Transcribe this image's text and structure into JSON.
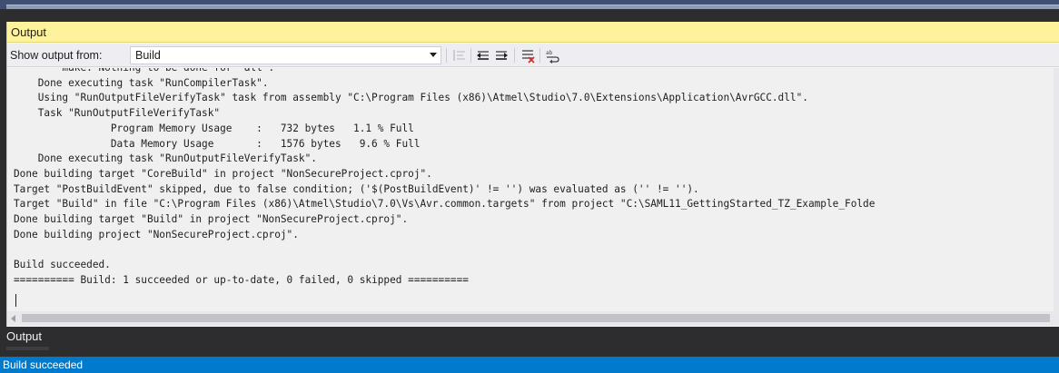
{
  "panel": {
    "title": "Output"
  },
  "toolbar": {
    "show_output_label": "Show output from:",
    "source_selected": "Build",
    "icons": [
      "find-message-in-code-icon",
      "go-to-previous-message-icon",
      "go-to-next-message-icon",
      "clear-all-icon",
      "toggle-word-wrap-icon"
    ]
  },
  "output": {
    "lines": [
      "        make: Nothing to be done for 'all'.",
      "    Done executing task \"RunCompilerTask\".",
      "    Using \"RunOutputFileVerifyTask\" task from assembly \"C:\\Program Files (x86)\\Atmel\\Studio\\7.0\\Extensions\\Application\\AvrGCC.dll\".",
      "    Task \"RunOutputFileVerifyTask\"",
      "                Program Memory Usage    :   732 bytes   1.1 % Full",
      "                Data Memory Usage       :   1576 bytes   9.6 % Full",
      "    Done executing task \"RunOutputFileVerifyTask\".",
      "Done building target \"CoreBuild\" in project \"NonSecureProject.cproj\".",
      "Target \"PostBuildEvent\" skipped, due to false condition; ('$(PostBuildEvent)' != '') was evaluated as ('' != '').",
      "Target \"Build\" in file \"C:\\Program Files (x86)\\Atmel\\Studio\\7.0\\Vs\\Avr.common.targets\" from project \"C:\\SAML11_GettingStarted_TZ_Example_Folde",
      "Done building target \"Build\" in project \"NonSecureProject.cproj\".",
      "Done building project \"NonSecureProject.cproj\".",
      "",
      "Build succeeded.",
      "========== Build: 1 succeeded or up-to-date, 0 failed, 0 skipped =========="
    ]
  },
  "bottom_tab": {
    "label": "Output"
  },
  "status_bar": {
    "text": "Build succeeded"
  },
  "colors": {
    "title_bar": "#fff29d",
    "status_bar": "#007acc",
    "chrome_dark": "#2d2d30",
    "output_bg": "#f0f0f0"
  }
}
